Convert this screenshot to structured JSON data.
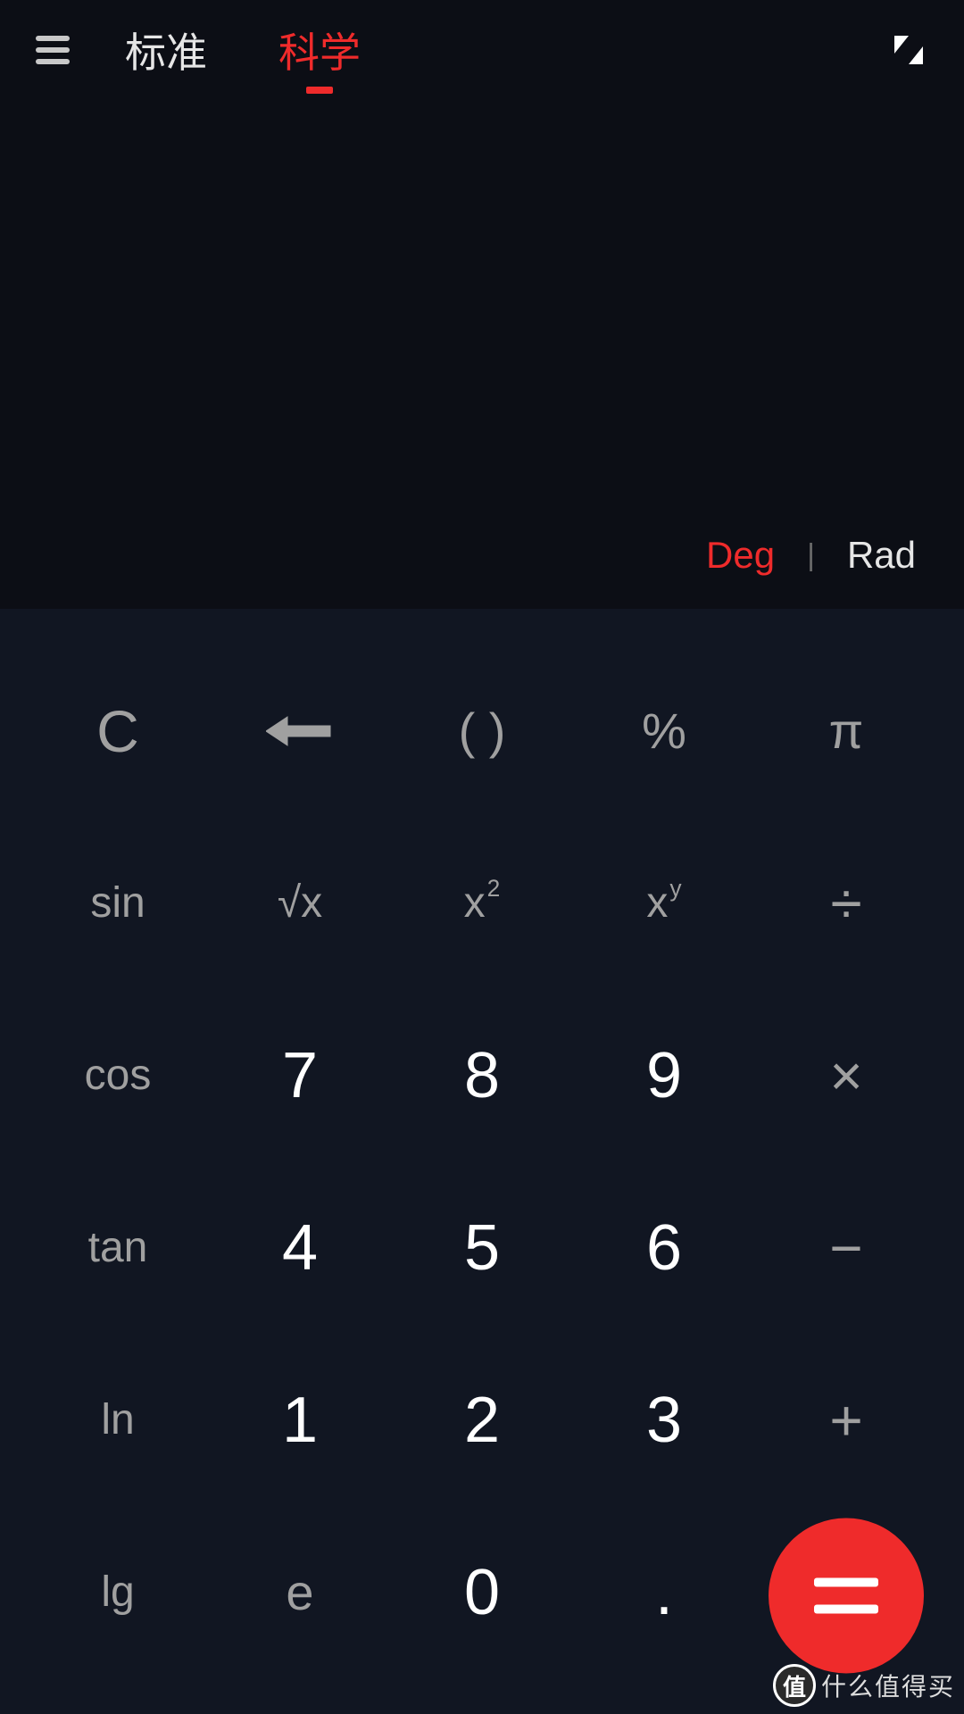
{
  "header": {
    "tab_standard": "标准",
    "tab_scientific": "科学"
  },
  "display": {
    "deg": "Deg",
    "sep": "|",
    "rad": "Rad"
  },
  "keys": {
    "clear": "C",
    "parens": "( )",
    "percent": "%",
    "pi": "π",
    "sin": "sin",
    "sqrt": "√x",
    "sq_base": "x",
    "sq_exp": "2",
    "pow_base": "x",
    "pow_exp": "y",
    "divide": "÷",
    "cos": "cos",
    "n7": "7",
    "n8": "8",
    "n9": "9",
    "multiply": "×",
    "tan": "tan",
    "n4": "4",
    "n5": "5",
    "n6": "6",
    "minus": "−",
    "ln": "ln",
    "n1": "1",
    "n2": "2",
    "n3": "3",
    "plus": "+",
    "lg": "lg",
    "e": "e",
    "n0": "0",
    "dot": "."
  },
  "watermark": {
    "badge": "值",
    "text": "什么值得买"
  },
  "colors": {
    "accent": "#ef2b2b",
    "bg": "#0c0e15",
    "panel": "#111622"
  }
}
